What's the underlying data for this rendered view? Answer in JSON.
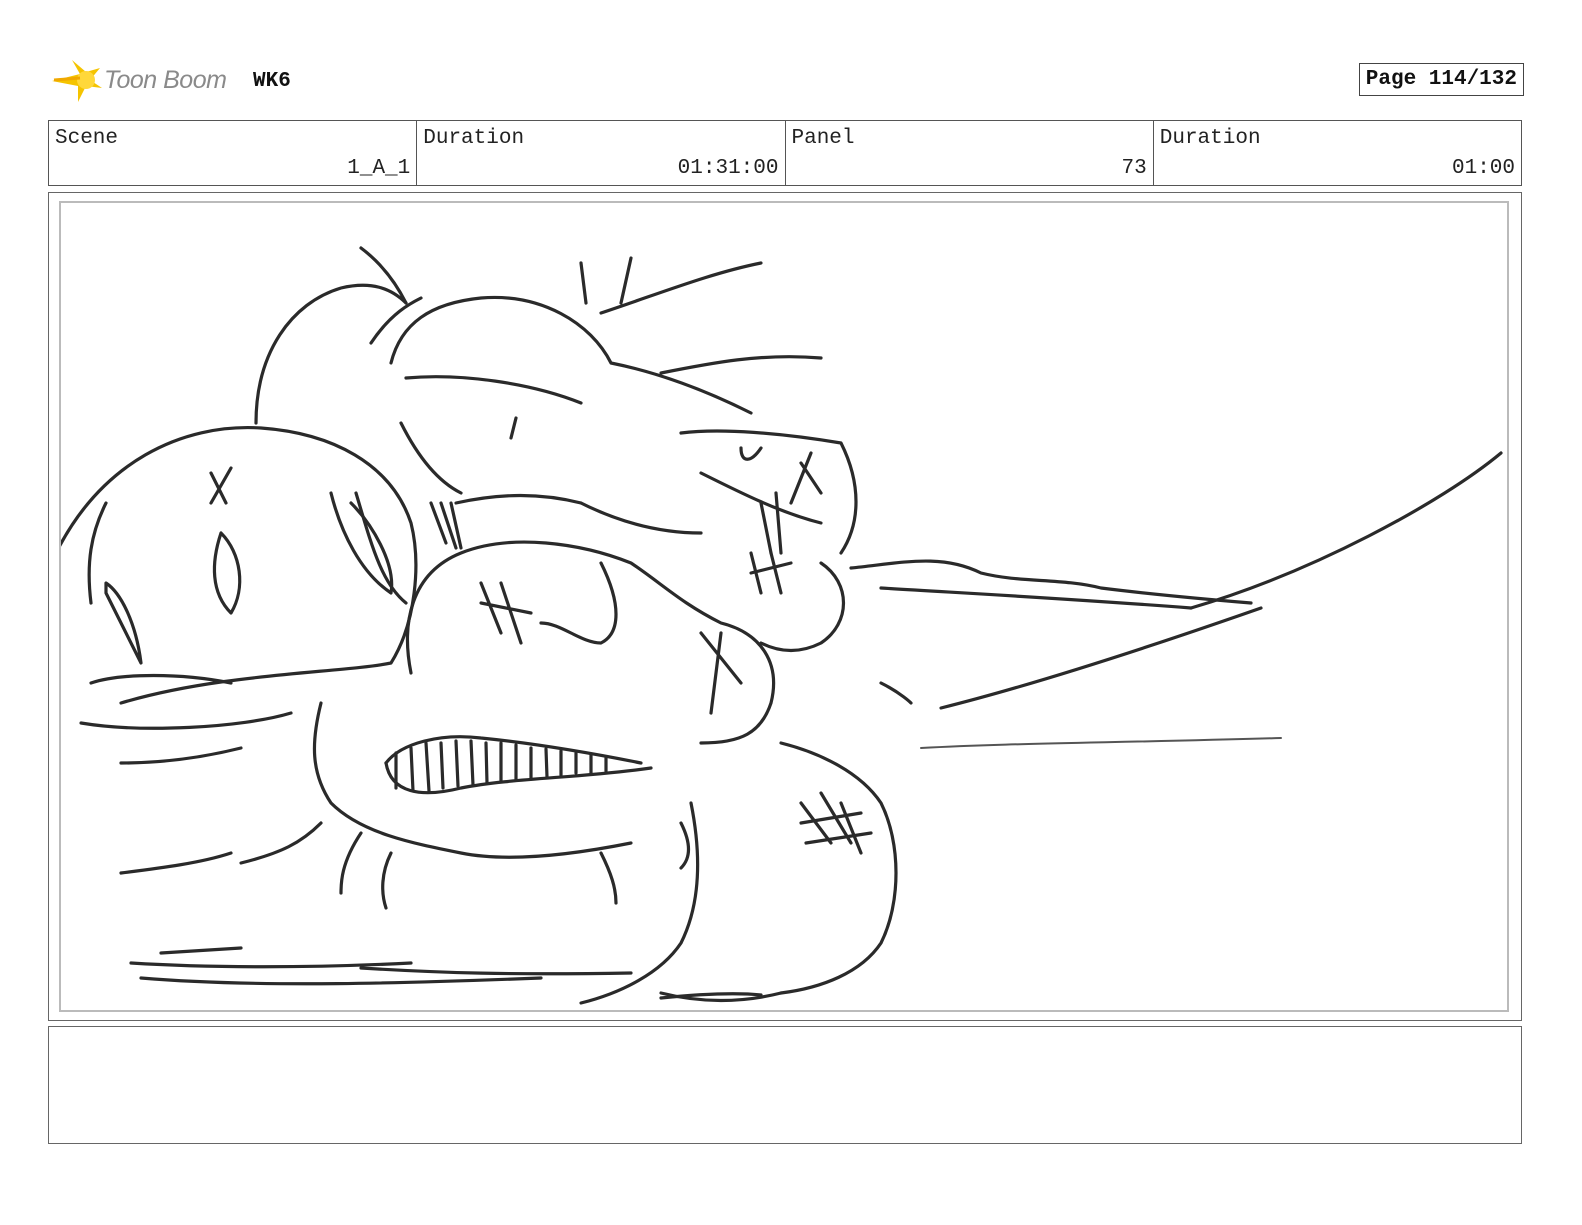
{
  "header": {
    "logo_text": "Toon Boom",
    "project": "WK6",
    "page_label": "Page 114/132"
  },
  "info": {
    "scene_label": "Scene",
    "scene_value": "1_A_1",
    "duration_label": "Duration",
    "duration_value": "01:31:00",
    "panel_label": "Panel",
    "panel_value": "73",
    "panel_duration_label": "Duration",
    "panel_duration_value": "01:00"
  },
  "panel": {
    "image": "storyboard-sketch"
  },
  "notes": {
    "text": ""
  },
  "colors": {
    "logo_yellow": "#f5c400",
    "border": "#555555"
  }
}
